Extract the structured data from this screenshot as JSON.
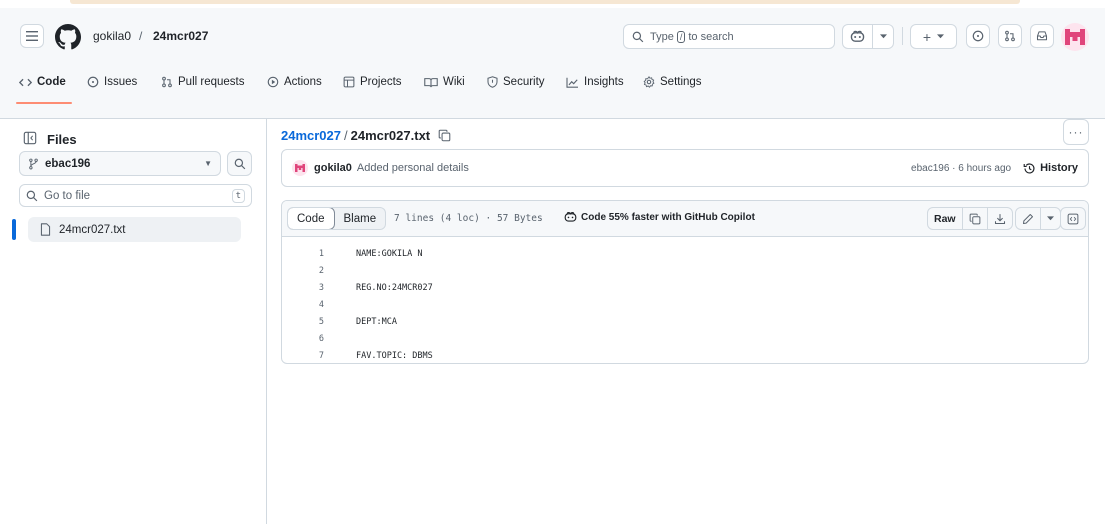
{
  "header": {
    "owner": "gokila0",
    "separator": "/",
    "repo": "24mcr027",
    "search": {
      "prefix": "Type",
      "key": "/",
      "suffix": "to search"
    },
    "tabs": [
      {
        "label": "Code",
        "icon": "code-icon"
      },
      {
        "label": "Issues",
        "icon": "issue-icon"
      },
      {
        "label": "Pull requests",
        "icon": "pull-request-icon"
      },
      {
        "label": "Actions",
        "icon": "play-icon"
      },
      {
        "label": "Projects",
        "icon": "table-icon"
      },
      {
        "label": "Wiki",
        "icon": "book-icon"
      },
      {
        "label": "Security",
        "icon": "shield-icon"
      },
      {
        "label": "Insights",
        "icon": "graph-icon"
      },
      {
        "label": "Settings",
        "icon": "gear-icon"
      }
    ]
  },
  "sidebar": {
    "title": "Files",
    "branch": "ebac196",
    "goto_placeholder": "Go to file",
    "goto_key": "t",
    "files": [
      "24mcr027.txt"
    ]
  },
  "main": {
    "repo_link": "24mcr027",
    "path_sep": "/",
    "filename": "24mcr027.txt",
    "commit": {
      "author": "gokila0",
      "message": "Added personal details",
      "meta": "ebac196 · 6 hours ago",
      "history_label": "History"
    },
    "file_header": {
      "code_tab": "Code",
      "blame_tab": "Blame",
      "info": "7 lines (4 loc) · 57 Bytes",
      "copilot": "Code 55% faster with GitHub Copilot",
      "raw": "Raw"
    },
    "lines": [
      {
        "n": "1",
        "text": "NAME:GOKILA N"
      },
      {
        "n": "2",
        "text": ""
      },
      {
        "n": "3",
        "text": "REG.NO:24MCR027"
      },
      {
        "n": "4",
        "text": ""
      },
      {
        "n": "5",
        "text": "DEPT:MCA"
      },
      {
        "n": "6",
        "text": ""
      },
      {
        "n": "7",
        "text": "FAV.TOPIC: DBMS"
      }
    ]
  },
  "colors": {
    "accent_link": "#0969da",
    "tab_underline": "#fd8c73",
    "avatar": "#e0457b"
  }
}
